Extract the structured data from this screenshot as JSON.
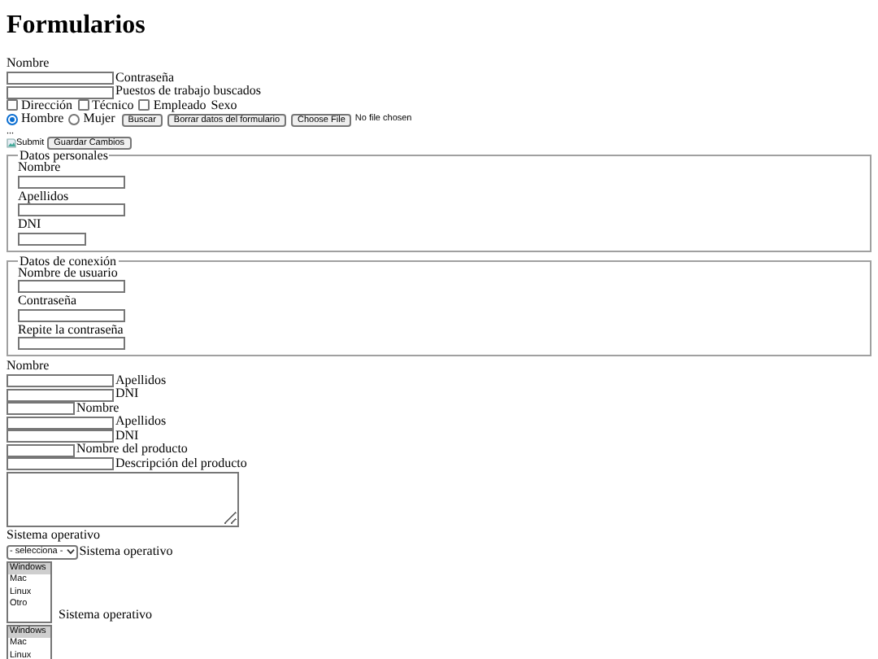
{
  "title": "Formularios",
  "blocks": [
    {
      "kind": "row",
      "items": [
        {
          "kind": "text",
          "text": "Nombre"
        }
      ]
    },
    {
      "kind": "row",
      "items": [
        {
          "kind": "input"
        },
        {
          "kind": "text",
          "text": "Contraseña"
        }
      ]
    },
    {
      "kind": "row",
      "items": [
        {
          "kind": "input"
        },
        {
          "kind": "text",
          "text": "Puestos de trabajo buscados"
        }
      ]
    },
    {
      "kind": "row",
      "items": [
        {
          "kind": "checkbox",
          "checked": false,
          "label": "Dirección"
        },
        {
          "kind": "checkbox",
          "checked": false,
          "label": "Técnico"
        },
        {
          "kind": "checkbox",
          "checked": false,
          "label": "Empleado"
        },
        {
          "kind": "text",
          "text": "Sexo"
        }
      ]
    },
    {
      "kind": "row",
      "items": [
        {
          "kind": "radio",
          "selected": true,
          "label": "Hombre"
        },
        {
          "kind": "radio",
          "selected": false,
          "label": "Mujer"
        },
        {
          "kind": "button",
          "text": "Buscar"
        },
        {
          "kind": "button",
          "text": "Borrar datos del formulario"
        },
        {
          "kind": "button",
          "text": "Choose File"
        },
        {
          "kind": "note",
          "text": "No file chosen"
        }
      ]
    },
    {
      "kind": "row",
      "items": [
        {
          "kind": "small",
          "text": "..."
        }
      ]
    },
    {
      "kind": "row",
      "items": [
        {
          "kind": "image",
          "text": "Submit"
        },
        {
          "kind": "button",
          "text": "Guardar Cambios"
        }
      ]
    },
    {
      "kind": "fieldset",
      "legend": "Datos personales",
      "fields": [
        {
          "label": "Nombre",
          "kind": "input"
        },
        {
          "label": "Apellidos",
          "kind": "input"
        },
        {
          "label": "DNI",
          "kind": "input-short"
        }
      ]
    },
    {
      "kind": "fieldset",
      "legend": "Datos de conexión",
      "fields": [
        {
          "label": "Nombre de usuario",
          "kind": "input"
        },
        {
          "label": "Contraseña",
          "kind": "input"
        },
        {
          "label": "Repite la contraseña",
          "kind": "input"
        }
      ]
    },
    {
      "kind": "row",
      "items": [
        {
          "kind": "text",
          "text": "Nombre"
        }
      ]
    },
    {
      "kind": "row",
      "items": [
        {
          "kind": "input"
        },
        {
          "kind": "text",
          "text": "Apellidos"
        }
      ]
    },
    {
      "kind": "row",
      "items": [
        {
          "kind": "input"
        },
        {
          "kind": "text",
          "text": "DNI"
        }
      ]
    },
    {
      "kind": "row",
      "items": [
        {
          "kind": "input-short"
        },
        {
          "kind": "text",
          "text": "Nombre"
        }
      ]
    },
    {
      "kind": "row",
      "items": [
        {
          "kind": "input"
        },
        {
          "kind": "text",
          "text": "Apellidos"
        }
      ]
    },
    {
      "kind": "row",
      "items": [
        {
          "kind": "input"
        },
        {
          "kind": "text",
          "text": "DNI"
        }
      ]
    },
    {
      "kind": "row",
      "items": [
        {
          "kind": "input-short"
        },
        {
          "kind": "text",
          "text": "Nombre del producto"
        }
      ]
    },
    {
      "kind": "row",
      "items": [
        {
          "kind": "input"
        },
        {
          "kind": "text",
          "text": "Descripción del producto"
        }
      ]
    },
    {
      "kind": "row",
      "items": [
        {
          "kind": "textarea"
        }
      ]
    },
    {
      "kind": "row",
      "items": [
        {
          "kind": "text",
          "text": "Sistema operativo"
        }
      ]
    },
    {
      "kind": "row",
      "items": [
        {
          "kind": "select",
          "value": "- selecciona -"
        },
        {
          "kind": "text",
          "text": "Sistema operativo"
        }
      ]
    },
    {
      "kind": "row",
      "items": [
        {
          "kind": "listbox",
          "options": [
            {
              "text": "Windows",
              "selected": true
            },
            {
              "text": "Mac",
              "selected": false
            },
            {
              "text": "Linux",
              "selected": false
            },
            {
              "text": "Otro",
              "selected": false
            }
          ]
        },
        {
          "kind": "text",
          "text": "Sistema operativo"
        }
      ]
    },
    {
      "kind": "row",
      "items": [
        {
          "kind": "listbox-cut",
          "options": [
            {
              "text": "Windows",
              "selected": true
            },
            {
              "text": "Mac",
              "selected": false
            },
            {
              "text": "Linux",
              "selected": false
            }
          ]
        }
      ]
    }
  ]
}
